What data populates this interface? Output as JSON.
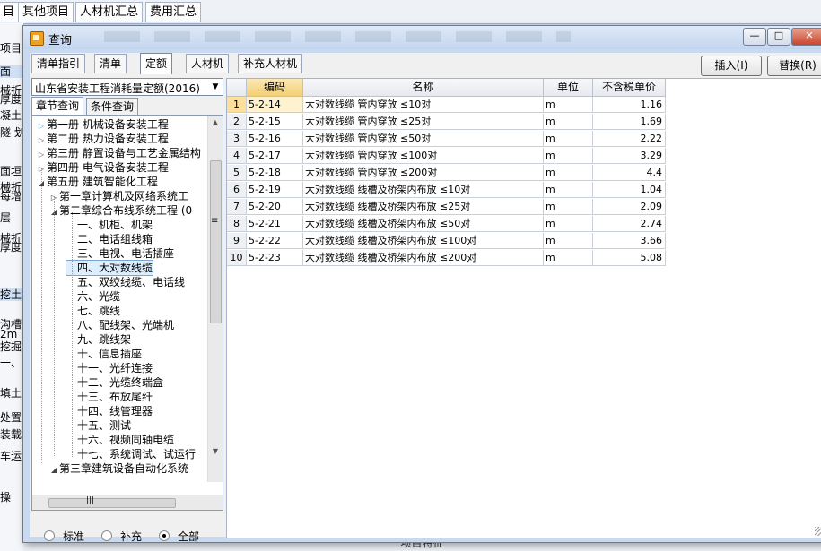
{
  "background": {
    "tabs": [
      "目",
      "其他项目",
      "人材机汇总",
      "费用汇总"
    ],
    "side_rows": [
      "项目",
      "面",
      "械折",
      "厚度",
      "凝土",
      "隧 划",
      "面垣",
      "械折",
      "每增",
      "层",
      "械折",
      "厚度",
      "挖土方",
      "沟槽",
      "2m",
      "挖掘机",
      "一、",
      "",
      "填土",
      "处置",
      "装载机",
      "车运",
      "",
      "操"
    ],
    "bottom_text": "项目特征"
  },
  "dialog": {
    "title": "查询",
    "window_buttons": {
      "minimize": "—",
      "maximize": "□",
      "close": "✕"
    },
    "tabs": [
      "清单指引",
      "清单",
      "定额",
      "人材机",
      "补充人材机"
    ],
    "active_tab": "定额",
    "insert_button": "插入(I)",
    "replace_button": "替换(R)",
    "quota_library": "山东省安装工程消耗量定额(2016)",
    "subtabs": [
      "章节查询",
      "条件查询"
    ],
    "active_subtab": "章节查询",
    "tree": [
      {
        "label": "第一册 机械设备安装工程",
        "toggle": "▷",
        "toggle_color": "#3aa0e0"
      },
      {
        "label": "第二册 热力设备安装工程",
        "toggle": "▷"
      },
      {
        "label": "第三册 静置设备与工艺金属结构",
        "toggle": "▷"
      },
      {
        "label": "第四册 电气设备安装工程",
        "toggle": "▷"
      },
      {
        "label": "第五册 建筑智能化工程",
        "toggle": "◢"
      },
      {
        "label": "第一章计算机及网络系统工",
        "toggle": "▷"
      },
      {
        "label": "第二章综合布线系统工程 (0",
        "toggle": "◢"
      },
      {
        "label": "一、机柜、机架",
        "toggle": ""
      },
      {
        "label": "二、电话组线箱",
        "toggle": ""
      },
      {
        "label": "三、电视、电话插座",
        "toggle": ""
      },
      {
        "label": "四、大对数线缆",
        "toggle": "",
        "selected": true
      },
      {
        "label": "五、双绞线缆、电话线",
        "toggle": ""
      },
      {
        "label": "六、光缆",
        "toggle": ""
      },
      {
        "label": "七、跳线",
        "toggle": ""
      },
      {
        "label": "八、配线架、光端机",
        "toggle": ""
      },
      {
        "label": "九、跳线架",
        "toggle": ""
      },
      {
        "label": "十、信息插座",
        "toggle": ""
      },
      {
        "label": "十一、光纤连接",
        "toggle": ""
      },
      {
        "label": "十二、光缆终端盒",
        "toggle": ""
      },
      {
        "label": "十三、布放尾纤",
        "toggle": ""
      },
      {
        "label": "十四、线管理器",
        "toggle": ""
      },
      {
        "label": "十五、测试",
        "toggle": ""
      },
      {
        "label": "十六、视频同轴电缆",
        "toggle": ""
      },
      {
        "label": "十七、系统调试、试运行",
        "toggle": ""
      },
      {
        "label": "第三章建筑设备自动化系统",
        "toggle": "◢"
      }
    ],
    "scroll_glyphs": {
      "up": "▲",
      "down": "▼",
      "grip": "≡",
      "hgrip": "|||"
    },
    "filter_options": [
      {
        "label": "标准",
        "checked": false
      },
      {
        "label": "补充",
        "checked": false
      },
      {
        "label": "全部",
        "checked": true
      }
    ],
    "grid": {
      "columns": [
        "",
        "编码",
        "名称",
        "单位",
        "不含税单价"
      ],
      "rows": [
        {
          "n": "1",
          "code": "5-2-14",
          "name": "大对数线缆 管内穿放 ≤10对",
          "unit": "m",
          "price": "1.16"
        },
        {
          "n": "2",
          "code": "5-2-15",
          "name": "大对数线缆 管内穿放 ≤25对",
          "unit": "m",
          "price": "1.69"
        },
        {
          "n": "3",
          "code": "5-2-16",
          "name": "大对数线缆 管内穿放 ≤50对",
          "unit": "m",
          "price": "2.22"
        },
        {
          "n": "4",
          "code": "5-2-17",
          "name": "大对数线缆 管内穿放 ≤100对",
          "unit": "m",
          "price": "3.29"
        },
        {
          "n": "5",
          "code": "5-2-18",
          "name": "大对数线缆 管内穿放 ≤200对",
          "unit": "m",
          "price": "4.4"
        },
        {
          "n": "6",
          "code": "5-2-19",
          "name": "大对数线缆 线槽及桥架内布放 ≤10对",
          "unit": "m",
          "price": "1.04"
        },
        {
          "n": "7",
          "code": "5-2-20",
          "name": "大对数线缆 线槽及桥架内布放 ≤25对",
          "unit": "m",
          "price": "2.09"
        },
        {
          "n": "8",
          "code": "5-2-21",
          "name": "大对数线缆 线槽及桥架内布放 ≤50对",
          "unit": "m",
          "price": "2.74"
        },
        {
          "n": "9",
          "code": "5-2-22",
          "name": "大对数线缆 线槽及桥架内布放 ≤100对",
          "unit": "m",
          "price": "3.66"
        },
        {
          "n": "10",
          "code": "5-2-23",
          "name": "大对数线缆 线槽及桥架内布放 ≤200对",
          "unit": "m",
          "price": "5.08"
        }
      ]
    }
  },
  "colors": {
    "title_bar": "#c3d5ee",
    "selection": "#fbdf9a",
    "tree_selection": "#ddeeff"
  }
}
